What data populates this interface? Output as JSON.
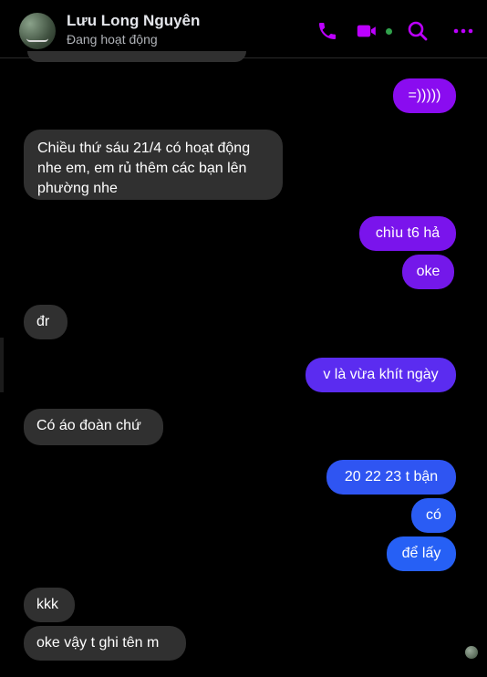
{
  "header": {
    "contact_name": "Lưu Long Nguyên",
    "status": "Đang hoạt động",
    "icons": [
      "phone-icon",
      "video-icon",
      "search-icon",
      "more-icon"
    ],
    "accent": "#bc00ff",
    "online_color": "#31a24c"
  },
  "messages": [
    {
      "id": "m1",
      "dir": "out",
      "text": "=)))))",
      "color": "#8a0cf0"
    },
    {
      "id": "m2",
      "dir": "in",
      "text": "Chiều thứ sáu 21/4 có hoạt động nhe em, em rủ thêm các bạn lên phường nhe",
      "lines": [
        "Chiều thứ sáu 21/4 có hoạt động",
        "nhe em, em rủ thêm các bạn lên",
        "phường nhe"
      ]
    },
    {
      "id": "m3",
      "dir": "out",
      "text": "chìu t6 hả",
      "color": "#7a14ec"
    },
    {
      "id": "m4",
      "dir": "out",
      "text": "oke",
      "color": "#7418ea"
    },
    {
      "id": "m5",
      "dir": "in",
      "text": "đr"
    },
    {
      "id": "m6",
      "dir": "out",
      "text": "v là vừa khít ngày",
      "color": "#5b2cf0"
    },
    {
      "id": "m7",
      "dir": "in",
      "text": "Có áo đoàn chứ"
    },
    {
      "id": "m8",
      "dir": "out",
      "text": "20 22 23 t bận",
      "color": "#2f55f2"
    },
    {
      "id": "m9",
      "dir": "out",
      "text": "có",
      "color": "#2a5cf4"
    },
    {
      "id": "m10",
      "dir": "out",
      "text": "để lấy",
      "color": "#2660f5"
    },
    {
      "id": "m11",
      "dir": "in",
      "text": "kkk"
    },
    {
      "id": "m12",
      "dir": "in",
      "text": "oke vậy t ghi tên m"
    }
  ]
}
